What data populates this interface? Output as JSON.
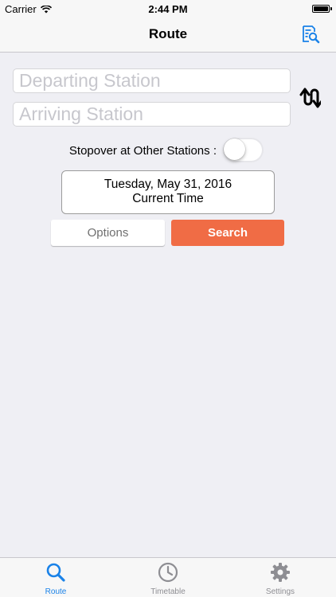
{
  "status_bar": {
    "carrier": "Carrier",
    "time": "2:44 PM",
    "battery_level": 1.0
  },
  "nav": {
    "title": "Route",
    "right_icon": "search-document-icon"
  },
  "form": {
    "departing_placeholder": "Departing Station",
    "departing_value": "",
    "arriving_placeholder": "Arriving Station",
    "arriving_value": "",
    "swap_icon": "swap-arrows-icon",
    "stopover_label": "Stopover at Other Stations :",
    "stopover_enabled": false,
    "date_line": "Tuesday, May 31, 2016",
    "time_line": "Current Time",
    "options_label": "Options",
    "search_label": "Search"
  },
  "tabs": [
    {
      "label": "Route",
      "icon": "search-icon",
      "active": true
    },
    {
      "label": "Timetable",
      "icon": "clock-icon",
      "active": false
    },
    {
      "label": "Settings",
      "icon": "gear-icon",
      "active": false
    }
  ],
  "colors": {
    "accent_blue": "#1a82e8",
    "search_orange": "#f06c45",
    "inactive_gray": "#8e8e93",
    "background": "#efeff4"
  }
}
